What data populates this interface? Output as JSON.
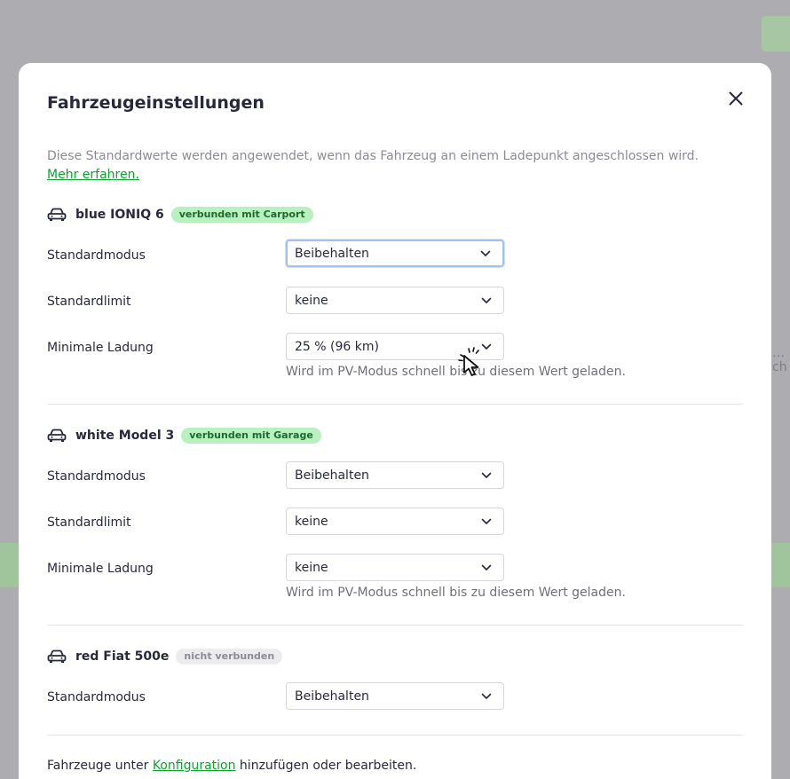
{
  "background": {
    "right_text": "…ch"
  },
  "modal": {
    "title": "Fahrzeugeinstellungen",
    "intro_text": "Diese Standardwerte werden angewendet, wenn das Fahrzeug an einem Ladepunkt angeschlossen wird.",
    "intro_link": "Mehr erfahren.",
    "footer_prefix": "Fahrzeuge unter ",
    "footer_link": "Konfiguration",
    "footer_suffix": " hinzufügen oder bearbeiten."
  },
  "labels": {
    "mode": "Standardmodus",
    "limit": "Standardlimit",
    "min_charge": "Minimale Ladung",
    "min_charge_hint": "Wird im PV-Modus schnell bis zu diesem Wert geladen."
  },
  "vehicles": [
    {
      "name": "blue IONIQ 6",
      "status": "verbunden mit Carport",
      "mode": "Beibehalten",
      "limit": "keine",
      "min_charge": "25 % (96 km)"
    },
    {
      "name": "white Model 3",
      "status": "verbunden mit Garage",
      "mode": "Beibehalten",
      "limit": "keine",
      "min_charge": "keine"
    },
    {
      "name": "red Fiat 500e",
      "status": "nicht verbunden",
      "mode": "Beibehalten"
    }
  ],
  "colors": {
    "accent_green": "#0fa12e",
    "badge_connected_bg": "#b8f0c0",
    "badge_disconnected_bg": "#ececee",
    "focus_ring": "#9ec3f3"
  },
  "icons": [
    "close-icon",
    "car-icon",
    "chevron-down-icon",
    "pointer-cursor-icon"
  ]
}
